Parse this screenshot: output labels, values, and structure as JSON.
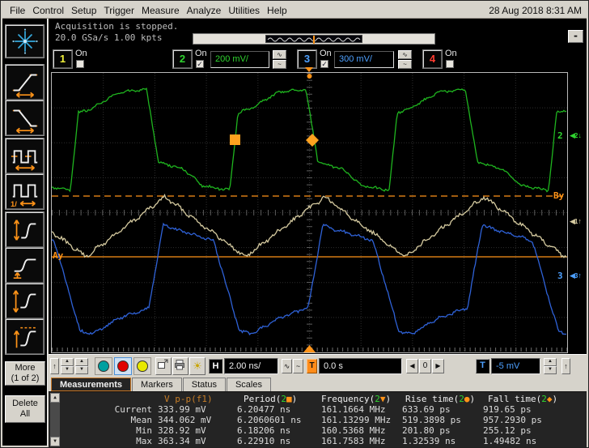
{
  "titlebar": {
    "date": "28 Aug 2018 8:31 AM"
  },
  "menu": {
    "items": [
      "File",
      "Control",
      "Setup",
      "Trigger",
      "Measure",
      "Analyze",
      "Utilities",
      "Help"
    ]
  },
  "acquisition": {
    "status": "Acquisition is stopped.",
    "rate": "20.0 GSa/s  1.00 kpts",
    "minimize": "-"
  },
  "channels": [
    {
      "num": "1",
      "on": "On",
      "checked": false,
      "color": "#f0f03a"
    },
    {
      "num": "2",
      "on": "On",
      "checked": true,
      "color": "#2fd42f",
      "scale": "200 mV/"
    },
    {
      "num": "3",
      "on": "On",
      "checked": true,
      "color": "#4da0ff",
      "scale": "300 mV/"
    },
    {
      "num": "4",
      "on": "On",
      "checked": false,
      "color": "#ff3b30"
    }
  ],
  "sidebar": {
    "more": {
      "line1": "More",
      "line2": "(1 of 2)"
    },
    "delete_all": {
      "line1": "Delete",
      "line2": "All"
    }
  },
  "plot": {
    "ch2_label": "2",
    "ch3_label": "3",
    "by_label": "By",
    "ay_label": "Ay",
    "colors": {
      "ch2": "#1fb51f",
      "ch3": "#2f62d8",
      "f1": "#d6cba0",
      "marker": "#ff9318"
    }
  },
  "toolbar": {
    "h_label": "H",
    "h_scale": "2.00 ns/",
    "trig_label": "T",
    "delay": "0.0 s",
    "zero": "0",
    "level_label": "T",
    "level": "-5 mV"
  },
  "tabs": [
    {
      "label": "Measurements",
      "active": true
    },
    {
      "label": "Markers",
      "active": false
    },
    {
      "label": "Status",
      "active": false
    },
    {
      "label": "Scales",
      "active": false
    }
  ],
  "measurements": {
    "headers": [
      {
        "text": "V p-p(f1)",
        "color": "#c87e28"
      },
      {
        "pre": "Period(",
        "ch": "2",
        "sym": "■",
        "post": ")"
      },
      {
        "pre": "Frequency(",
        "ch": "2",
        "sym": "▼",
        "post": ")"
      },
      {
        "pre": "Rise time(",
        "ch": "2",
        "sym": "●",
        "post": ")"
      },
      {
        "pre": "Fall time(",
        "ch": "2",
        "sym": "◆",
        "post": ")"
      }
    ],
    "rows": [
      {
        "label": "Current",
        "values": [
          "333.99 mV",
          "6.20477 ns",
          "161.1664 MHz",
          "633.69 ps",
          "919.65 ps"
        ]
      },
      {
        "label": "Mean",
        "values": [
          "344.062 mV",
          "6.2060601 ns",
          "161.13299 MHz",
          "519.3898 ps",
          "957.2930 ps"
        ]
      },
      {
        "label": "Min",
        "values": [
          "328.92 mV",
          "6.18206 ns",
          "160.5368 MHz",
          "201.80 ps",
          "255.12 ps"
        ]
      },
      {
        "label": "Max",
        "values": [
          "363.34 mV",
          "6.22910 ns",
          "161.7583 MHz",
          "1.32539 ns",
          "1.49482 ns"
        ]
      }
    ]
  }
}
